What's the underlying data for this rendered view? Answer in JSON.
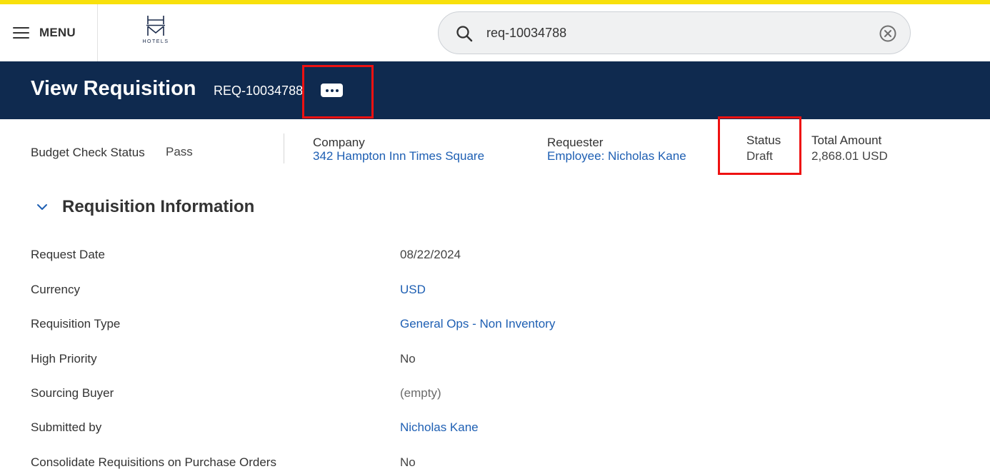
{
  "menu": {
    "label": "MENU"
  },
  "logo": {
    "text": "HOTELS"
  },
  "search": {
    "value": "req-10034788"
  },
  "header": {
    "title": "View Requisition",
    "requisition_id": "REQ-10034788"
  },
  "summary": {
    "budget_check": {
      "label": "Budget Check Status",
      "value": "Pass"
    },
    "company": {
      "label": "Company",
      "value": "342 Hampton Inn Times Square"
    },
    "requester": {
      "label": "Requester",
      "value": "Employee: Nicholas Kane"
    },
    "status": {
      "label": "Status",
      "value": "Draft"
    },
    "total": {
      "label": "Total Amount",
      "value": "2,868.01 USD"
    }
  },
  "section": {
    "title": "Requisition Information"
  },
  "fields": [
    {
      "label": "Request Date",
      "value": "08/22/2024"
    },
    {
      "label": "Currency",
      "value": "USD"
    },
    {
      "label": "Requisition Type",
      "value": "General Ops - Non Inventory"
    },
    {
      "label": "High Priority",
      "value": "No"
    },
    {
      "label": "Sourcing Buyer",
      "value": "(empty)"
    },
    {
      "label": "Submitted by",
      "value": "Nicholas Kane"
    },
    {
      "label": "Consolidate Requisitions on Purchase Orders",
      "value": "No"
    }
  ],
  "colors": {
    "accent_bar": "#f8e00c",
    "header_band": "#0f2a4f",
    "link": "#1e5fb3",
    "highlight": "#ee1111"
  },
  "icons": {
    "menu": "hamburger-icon",
    "search": "search-icon",
    "clear": "clear-circle-x-icon",
    "related_actions": "ellipsis-icon",
    "section_toggle": "chevron-down-icon"
  }
}
